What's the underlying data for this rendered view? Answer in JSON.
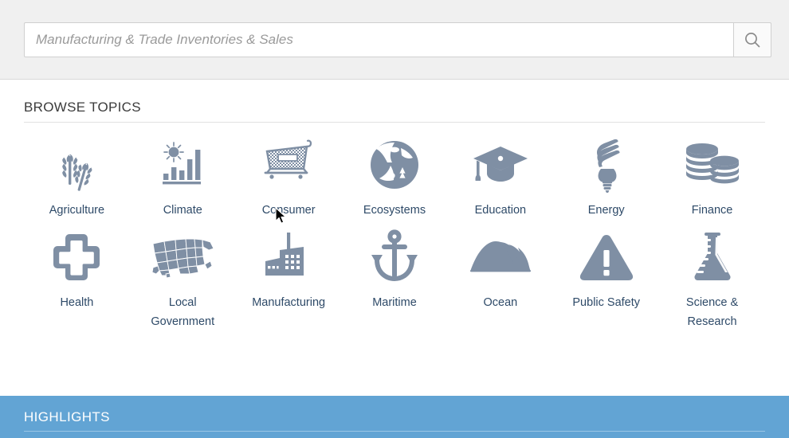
{
  "search": {
    "placeholder": "Manufacturing & Trade Inventories & Sales",
    "value": "",
    "button_icon": "search-icon",
    "button_label": ""
  },
  "browse": {
    "title": "BROWSE TOPICS",
    "topics": [
      {
        "label": "Agriculture",
        "icon": "wheat-icon"
      },
      {
        "label": "Climate",
        "icon": "sun-bar-chart-icon"
      },
      {
        "label": "Consumer",
        "icon": "shopping-cart-icon"
      },
      {
        "label": "Ecosystems",
        "icon": "nature-circle-icon"
      },
      {
        "label": "Education",
        "icon": "graduation-cap-icon"
      },
      {
        "label": "Energy",
        "icon": "light-bulb-icon"
      },
      {
        "label": "Finance",
        "icon": "coin-stack-icon"
      },
      {
        "label": "Health",
        "icon": "medical-cross-icon"
      },
      {
        "label": "Local Government",
        "icon": "usa-map-icon"
      },
      {
        "label": "Manufacturing",
        "icon": "factory-icon"
      },
      {
        "label": "Maritime",
        "icon": "anchor-icon"
      },
      {
        "label": "Ocean",
        "icon": "wave-icon"
      },
      {
        "label": "Public Safety",
        "icon": "warning-triangle-icon"
      },
      {
        "label": "Science & Research",
        "icon": "flask-icon"
      }
    ]
  },
  "highlights": {
    "title": "HIGHLIGHTS"
  },
  "colors": {
    "header_bg": "#f0f0f0",
    "icon": "#7f8fa4",
    "label": "#2e4a68",
    "highlights_bg": "#62a4d4",
    "highlights_rule": "#9ac6e6"
  }
}
